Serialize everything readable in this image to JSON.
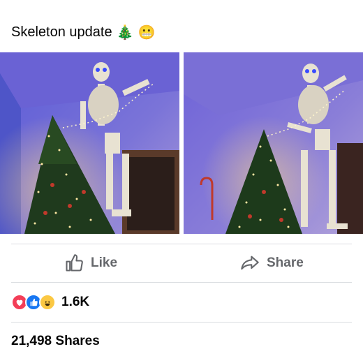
{
  "post": {
    "text": "Skeleton update",
    "emojis": [
      "🎄",
      "😬"
    ]
  },
  "photos": [
    {
      "name": "skeleton-tree-photo-1",
      "description_icon": "photo"
    },
    {
      "name": "skeleton-tree-photo-2",
      "description_icon": "photo"
    }
  ],
  "actions": {
    "like_label": "Like",
    "share_label": "Share"
  },
  "reactions": {
    "icons": [
      "love-icon",
      "like-icon",
      "haha-icon"
    ],
    "count": "1.6K"
  },
  "shares": {
    "text": "21,498 Shares"
  },
  "colors": {
    "action_gray": "#65676b",
    "divider": "#dadde1",
    "love": "#f33e58",
    "like": "#1877f2",
    "haha": "#fbc843"
  }
}
